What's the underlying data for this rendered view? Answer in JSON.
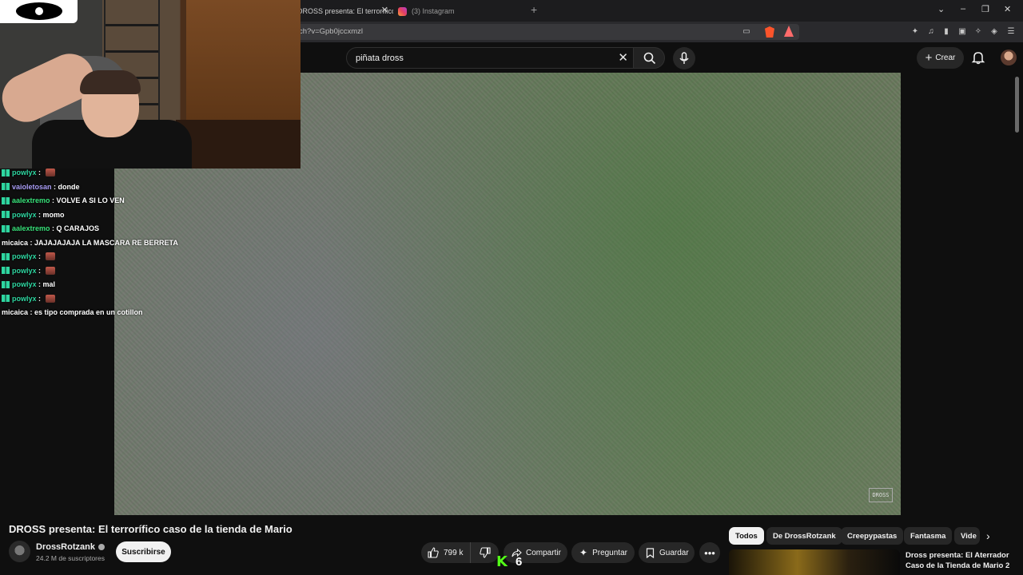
{
  "browser": {
    "tabs": [
      {
        "label": "DROSS presenta: El terrorífico"
      },
      {
        "label": "(3) Instagram"
      }
    ],
    "url": "ch?v=Gpb0jccxmzl",
    "window_controls": [
      "⌄",
      "–",
      "❐",
      "✕"
    ]
  },
  "youtube": {
    "search": {
      "value": "piñata dross"
    },
    "create_label": "Crear",
    "video": {
      "title": "DROSS presenta: El terrorífico caso de la tienda de Mario",
      "channel": "DrossRotzank",
      "subscribers": "24.2 M de suscriptores",
      "subscribe_label": "Suscribirse",
      "likes": "799 k",
      "share_label": "Compartir",
      "ask_label": "Preguntar",
      "save_label": "Guardar",
      "watermark": "DROSS"
    },
    "chips": [
      "Todos",
      "De DrossRotzank",
      "Creepypastas",
      "Fantasma",
      "Vide"
    ],
    "recommended": {
      "title": "Dross presenta: El Aterrador Caso de la Tienda de Mario 2"
    }
  },
  "overlay": {
    "kick_count": "6",
    "chat": [
      {
        "user": "powlyx",
        "color": "#2ed6a0",
        "message": "",
        "emote": true,
        "badge": true
      },
      {
        "user": "vaioletosan",
        "color": "#a99cf5",
        "message": "donde",
        "emote": false,
        "badge": true
      },
      {
        "user": "aalextremo",
        "color": "#38e27a",
        "message": "VOLVE A SI LO VEN",
        "emote": false,
        "badge": true
      },
      {
        "user": "powlyx",
        "color": "#2ed6a0",
        "message": "momo",
        "emote": false,
        "badge": true
      },
      {
        "user": "aalextremo",
        "color": "#38e27a",
        "message": "Q CARAJOS",
        "emote": false,
        "badge": true
      },
      {
        "user": "micaica",
        "color": "#ffffff",
        "message": "JAJAJAJAJA LA MASCARA RE BERRETA",
        "emote": false,
        "badge": false
      },
      {
        "user": "powlyx",
        "color": "#2ed6a0",
        "message": "",
        "emote": true,
        "badge": true
      },
      {
        "user": "powlyx",
        "color": "#2ed6a0",
        "message": "",
        "emote": true,
        "badge": true
      },
      {
        "user": "powlyx",
        "color": "#2ed6a0",
        "message": "mal",
        "emote": false,
        "badge": true
      },
      {
        "user": "powlyx",
        "color": "#2ed6a0",
        "message": "",
        "emote": true,
        "badge": true
      },
      {
        "user": "micaica",
        "color": "#ffffff",
        "message": "es tipo comprada en un cotillon",
        "emote": false,
        "badge": false
      }
    ]
  }
}
